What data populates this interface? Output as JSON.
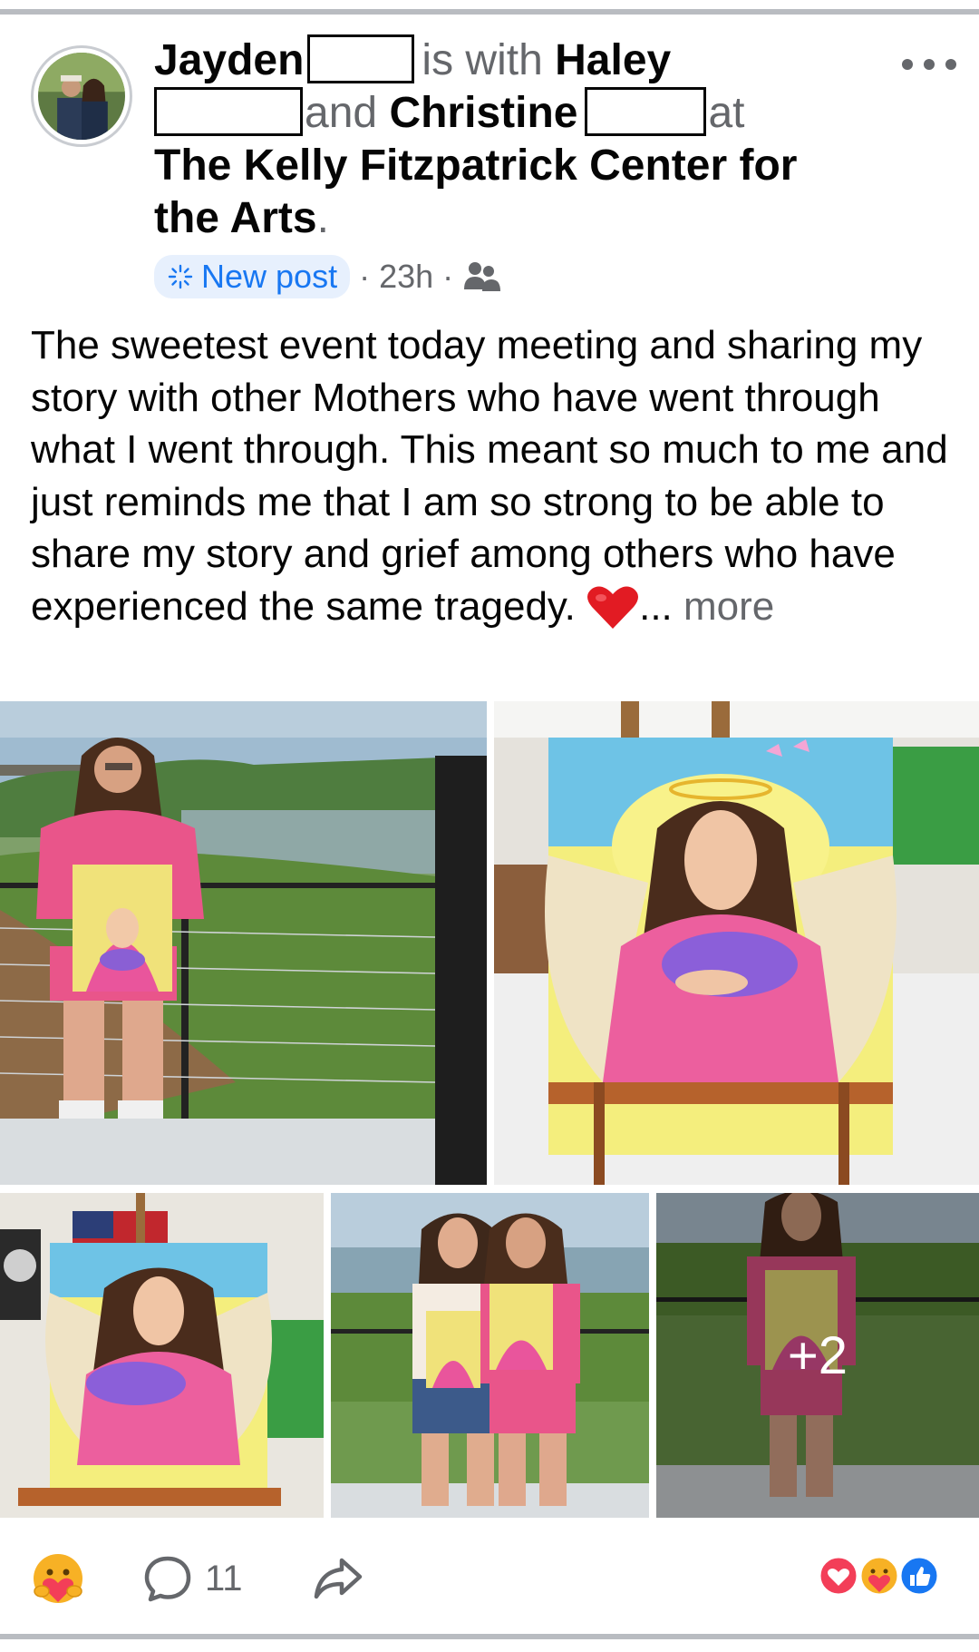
{
  "post": {
    "author": "Jayden",
    "with_text": "is with",
    "tagged_1": "Haley",
    "and_text": "and",
    "tagged_2": "Christine",
    "at_text": "at",
    "location": "The Kelly Fitzpatrick Center for the Arts",
    "period": ".",
    "badge_label": "New post",
    "time": "23h",
    "audience_icon": "friends-icon",
    "body": "The sweetest event today meeting and sharing my story with other Mothers who have went through what I went through. This meant so much to me and just reminds me that I am so strong to be able to share my story and grief among others who have experienced the same tragedy. ",
    "heart_emoji": "❤️",
    "ellipsis": "...",
    "more_label": "more"
  },
  "photos": {
    "extra_count": "+2"
  },
  "actions": {
    "react_icon": "care-react-icon",
    "comment_count": "11",
    "comment_icon": "comment-icon",
    "share_icon": "share-icon"
  },
  "reactions": [
    "love",
    "care",
    "like"
  ],
  "colors": {
    "accent": "#1877f2",
    "badge_bg": "#e7f0fd",
    "secondary_text": "#65676b",
    "love": "#f33e58",
    "care": "#f7b125",
    "like": "#1877f2",
    "pink_shirt": "#e9558a"
  }
}
